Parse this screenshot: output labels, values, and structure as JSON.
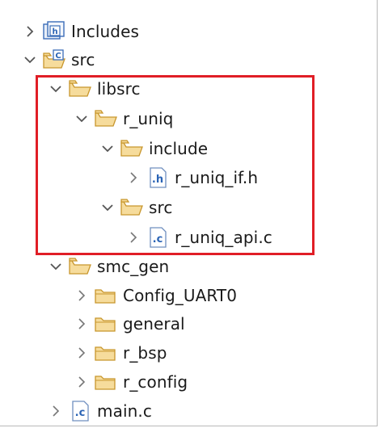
{
  "tree": {
    "items": [
      {
        "label": "Includes",
        "icon": "includes-icon",
        "state": "collapsed",
        "depth": 0
      },
      {
        "label": "src",
        "icon": "source-folder-icon",
        "state": "expanded",
        "depth": 0
      },
      {
        "label": "libsrc",
        "icon": "folder-open-icon",
        "state": "expanded",
        "depth": 1
      },
      {
        "label": "r_uniq",
        "icon": "folder-open-icon",
        "state": "expanded",
        "depth": 2
      },
      {
        "label": "include",
        "icon": "folder-open-icon",
        "state": "expanded",
        "depth": 3
      },
      {
        "label": "r_uniq_if.h",
        "icon": "header-file-icon",
        "state": "collapsed",
        "depth": 4
      },
      {
        "label": "src",
        "icon": "folder-open-icon",
        "state": "expanded",
        "depth": 3
      },
      {
        "label": "r_uniq_api.c",
        "icon": "c-file-icon",
        "state": "collapsed",
        "depth": 4
      },
      {
        "label": "smc_gen",
        "icon": "folder-open-icon",
        "state": "expanded",
        "depth": 1
      },
      {
        "label": "Config_UART0",
        "icon": "folder-closed-icon",
        "state": "collapsed",
        "depth": 2
      },
      {
        "label": "general",
        "icon": "folder-closed-icon",
        "state": "collapsed",
        "depth": 2
      },
      {
        "label": "r_bsp",
        "icon": "folder-closed-icon",
        "state": "collapsed",
        "depth": 2
      },
      {
        "label": "r_config",
        "icon": "folder-closed-icon",
        "state": "collapsed",
        "depth": 2
      },
      {
        "label": "main.c",
        "icon": "c-file-icon",
        "state": "collapsed",
        "depth": 1
      }
    ]
  },
  "colors": {
    "highlight": "#e01e26",
    "folder_fill": "#f6dc9c",
    "folder_stroke": "#c8962c",
    "file_blue": "#2b64b5",
    "chevron": "#555555"
  }
}
